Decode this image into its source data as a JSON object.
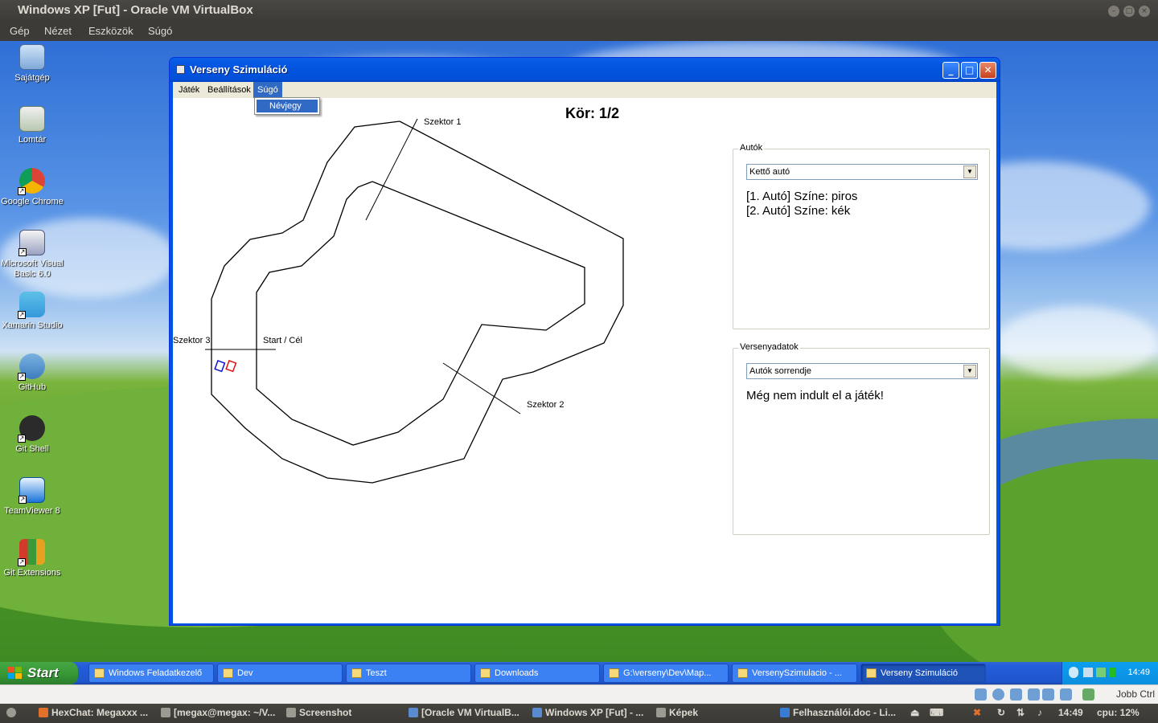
{
  "host_window": {
    "title": "Windows XP [Fut] - Oracle VM VirtualBox",
    "menu": [
      "Gép",
      "Nézet",
      "Eszközök",
      "Súgó"
    ]
  },
  "desktop_icons": [
    {
      "label": "Sajátgép",
      "icon": "my-computer-icon"
    },
    {
      "label": "Lomtár",
      "icon": "recycle-bin-icon"
    },
    {
      "label": "Google Chrome",
      "icon": "chrome-icon"
    },
    {
      "label": "Microsoft Visual Basic 6.0",
      "icon": "visual-basic-icon"
    },
    {
      "label": "Xamarin Studio",
      "icon": "xamarin-icon"
    },
    {
      "label": "GitHub",
      "icon": "github-icon"
    },
    {
      "label": "Git Shell",
      "icon": "git-shell-icon"
    },
    {
      "label": "TeamViewer 8",
      "icon": "teamviewer-icon"
    },
    {
      "label": "Git Extensions",
      "icon": "git-extensions-icon"
    }
  ],
  "app": {
    "title": "Verseny Szimuláció",
    "menu": [
      "Játék",
      "Beállítások",
      "Súgó"
    ],
    "active_menu": "Súgó",
    "dropdown_item": "Névjegy",
    "lap": "Kör: 1/2",
    "track_labels": {
      "sector1": "Szektor 1",
      "sector2": "Szektor 2",
      "sector3": "Szektor 3",
      "start_finish": "Start / Cél"
    },
    "cars_group": {
      "legend": "Autók",
      "selected": "Kettő autó",
      "lines": [
        "[1. Autó] Színe: piros",
        "[2. Autó] Színe: kék"
      ]
    },
    "race_group": {
      "legend": "Versenyadatok",
      "selected": "Autók sorrendje",
      "message": "Még nem indult el a játék!"
    },
    "car_colors": {
      "car1": "#e01010",
      "car2": "#1010d0"
    }
  },
  "xp_taskbar": {
    "start_label": "Start",
    "tasks": [
      "Windows Feladatkezelő",
      "Dev",
      "Teszt",
      "Downloads",
      "G:\\verseny\\Dev\\Map...",
      "VersenySzimulacio - ...",
      "Verseny Szimuláció"
    ],
    "clock": "14:49"
  },
  "vbox_status": {
    "host_key": "Jobb Ctrl"
  },
  "host_panel": {
    "items": [
      "HexChat: Megaxxx ...",
      "[megax@megax: ~/V...",
      "Screenshot",
      "[Oracle VM VirtualB...",
      "Windows XP [Fut] - ...",
      "Képek",
      "Felhasználói.doc - Li..."
    ],
    "clock": "14:49",
    "cpu": "cpu:  12%"
  }
}
